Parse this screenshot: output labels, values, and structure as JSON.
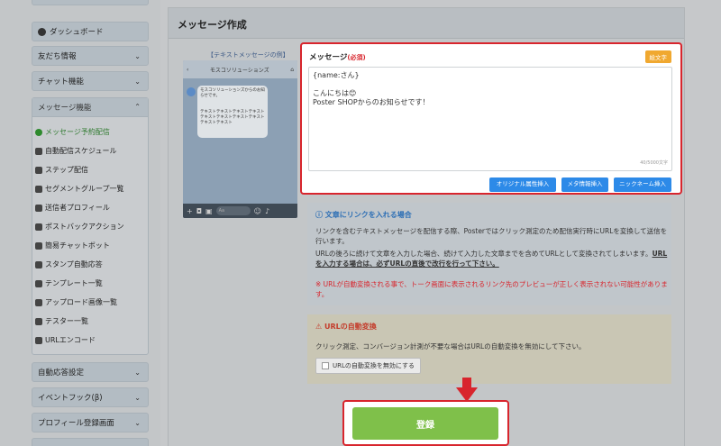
{
  "sidebar": {
    "search_placeholder": "",
    "dashboard": "ダッシュボード",
    "friends": "友だち情報",
    "chat": "チャット機能",
    "message_menu": "メッセージ機能",
    "items": [
      "メッセージ予約配信",
      "自動配信スケジュール",
      "ステップ配信",
      "セグメントグループ一覧",
      "送信者プロフィール",
      "ポストバックアクション",
      "簡易チャットボット",
      "スタンプ自動応答",
      "テンプレート一覧",
      "アップロード画像一覧",
      "テスター一覧",
      "URLエンコード"
    ],
    "auto_reply": "自動応答設定",
    "event_hook": "イベントフック(β)",
    "profile_screen": "プロフィール登録画面"
  },
  "main": {
    "title": "メッセージ作成"
  },
  "preview": {
    "caption": "【テキストメッセージの例】",
    "chat_title": "モスコソリューションズ",
    "bubble1": "モスコソリューションズからのお知らせです。",
    "bubble2": "テキストテキストテキストテキストテキストテキストテキストテキストテキストテキスト",
    "input_hint": "Aa"
  },
  "message": {
    "label": "メッセージ",
    "required": "(必須)",
    "emoji_button": "絵文字",
    "body": "{name:さん}\n\nこんにちは😊\nPoster SHOPからのお知らせです！",
    "counter": "40/5000文字",
    "btn_original": "オリジナル属性挿入",
    "btn_meta": "メタ情報挿入",
    "btn_nickname": "ニックネーム挿入"
  },
  "link_info": {
    "heading": "文章にリンクを入れる場合",
    "p1": "リンクを含むテキストメッセージを配信する際、Posterではクリック測定のため配信実行時にURLを変換して送信を行います。",
    "p2": "URLの後ろに続けて文章を入力した場合、続けて入力した文章までを含めてURLとして変換されてしまいます。",
    "p2_strong": "URLを入力する場合は、必ずURLの直後で改行を行って下さい。",
    "warning": "※ URLが自動変換される事で、トーク画面に表示されるリンク先のプレビューが正しく表示されない可能性があります。"
  },
  "url_info": {
    "heading": "URLの自動変換",
    "text": "クリック測定、コンバージョン計測が不要な場合はURLの自動変換を無効にして下さい。",
    "checkbox_label": "URLの自動変換を無効にする"
  },
  "register_button": "登録",
  "colors": {
    "accent": "#2d8ae8",
    "danger": "#d8252d",
    "success": "#7fc04a",
    "emoji": "#f0a830"
  }
}
